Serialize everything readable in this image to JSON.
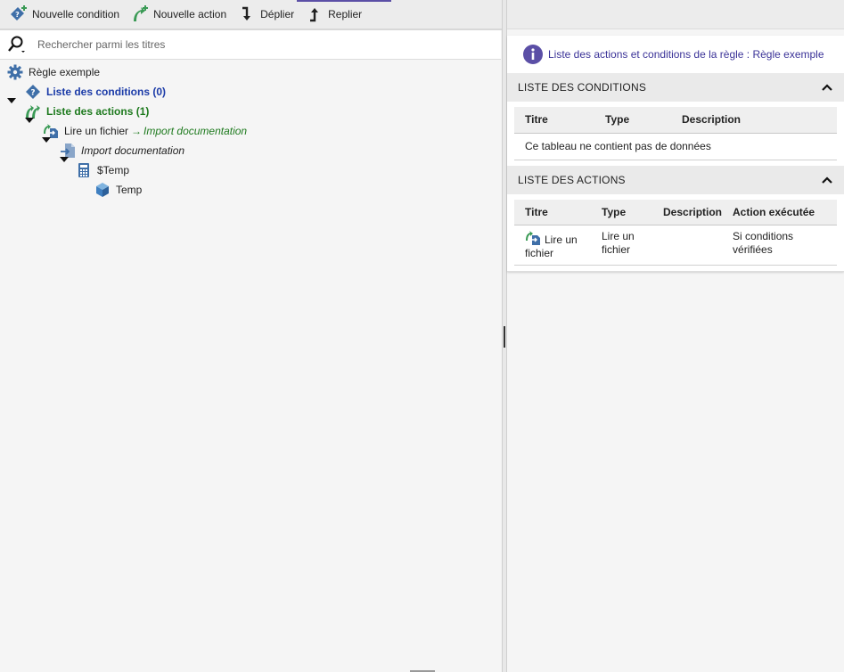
{
  "toolbar": {
    "new_condition": "Nouvelle condition",
    "new_action": "Nouvelle action",
    "expand": "Déplier",
    "collapse": "Replier"
  },
  "search": {
    "placeholder": "Rechercher parmi les titres"
  },
  "tree": {
    "root": "Règle exemple",
    "conditions": "Liste des conditions (0)",
    "actions": "Liste des actions (1)",
    "action_item": "Lire un fichier",
    "action_arrow": "→",
    "action_target": "Import documentation",
    "import_doc": "Import documentation",
    "variable": "$Temp",
    "object": "Temp"
  },
  "right": {
    "info_text": "Liste des actions et conditions de la règle : Règle exemple",
    "conditions_section": {
      "title": "LISTE DES CONDITIONS",
      "headers": [
        "Titre",
        "Type",
        "Description"
      ],
      "empty": "Ce tableau ne contient pas de données"
    },
    "actions_section": {
      "title": "LISTE DES ACTIONS",
      "headers": [
        "Titre",
        "Type",
        "Description",
        "Action exécutée"
      ],
      "rows": [
        {
          "title": "Lire un fichier",
          "type": "Lire un fichier",
          "description": "",
          "executed": "Si conditions vérifiées"
        }
      ]
    }
  },
  "colors": {
    "accent": "#5b4fa6",
    "blue_label": "#1b3ba8",
    "green_label": "#1e7a1e",
    "icon_blue": "#3f6fa8",
    "icon_green": "#3a9a55",
    "info_purple": "#5b4fa6"
  },
  "icons": [
    "new-condition-icon",
    "new-action-icon",
    "expand-icon",
    "collapse-icon",
    "search-icon",
    "gear-icon",
    "condition-icon",
    "actions-icon",
    "read-file-icon",
    "import-icon",
    "calculator-icon",
    "cube-icon",
    "info-icon",
    "chevron-up-icon"
  ]
}
